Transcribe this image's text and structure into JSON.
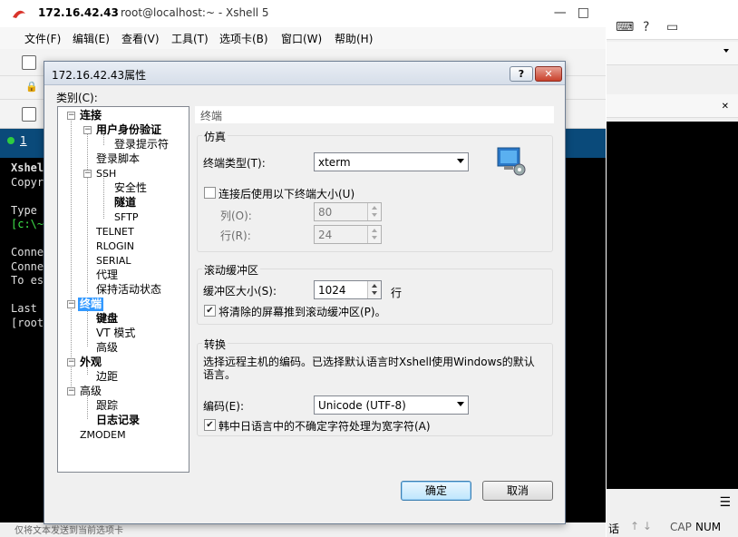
{
  "main_window": {
    "title_host": "172.16.42.43",
    "title_rest": "root@localhost:~ - Xshell 5",
    "menu": [
      "文件(F)",
      "编辑(E)",
      "查看(V)",
      "工具(T)",
      "选项卡(B)",
      "窗口(W)",
      "帮助(H)"
    ],
    "tab_label": "1",
    "terminal_lines": [
      "Xshel",
      "Copyr",
      "",
      "Type",
      "[c:\\~",
      "",
      "Conne",
      "Conne",
      "To es",
      "",
      "Last ",
      "[root"
    ],
    "status_text": "仅将文本发送到当前选项卡"
  },
  "right_strip": {
    "status_chars": "话",
    "cap": "CAP",
    "num": "NUM"
  },
  "dialog": {
    "title": "172.16.42.43属性",
    "help_btn": "?",
    "close_btn": "✕",
    "category_label": "类别(C):",
    "tree": {
      "connection": "连接",
      "user_auth": "用户身份验证",
      "login_prompt": "登录提示符",
      "login_script": "登录脚本",
      "ssh": "SSH",
      "security": "安全性",
      "tunnel": "隧道",
      "sftp": "SFTP",
      "telnet": "TELNET",
      "rlogin": "RLOGIN",
      "serial": "SERIAL",
      "proxy": "代理",
      "keepalive": "保持活动状态",
      "terminal": "终端",
      "keyboard": "键盘",
      "vt_mode": "VT 模式",
      "advanced": "高级",
      "appearance": "外观",
      "margins": "边距",
      "advanced2": "高级",
      "trace": "跟踪",
      "logging": "日志记录",
      "zmodem": "ZMODEM"
    },
    "content_header": "终端",
    "emulation": {
      "title": "仿真",
      "terminal_type_label": "终端类型(T):",
      "terminal_type_value": "xterm",
      "use_size_label": "连接后使用以下终端大小(U)",
      "use_size_checked": false,
      "cols_label": "列(O):",
      "cols_value": "80",
      "rows_label": "行(R):",
      "rows_value": "24"
    },
    "scroll_buffer": {
      "title": "滚动缓冲区",
      "size_label": "缓冲区大小(S):",
      "size_value": "1024",
      "unit": "行",
      "push_label": "将清除的屏幕推到滚动缓冲区(P)。",
      "push_checked": true
    },
    "translation": {
      "title": "转换",
      "desc": "选择远程主机的编码。已选择默认语言时Xshell使用Windows的默认语言。",
      "encoding_label": "编码(E):",
      "encoding_value": "Unicode (UTF-8)",
      "cjk_label": "韩中日语言中的不确定字符处理为宽字符(A)",
      "cjk_checked": true
    },
    "ok_btn": "确定",
    "cancel_btn": "取消"
  },
  "colors": {
    "selection": "#3399ff",
    "terminal_bg": "#000000",
    "tab_bar": "#0a4a7a"
  }
}
